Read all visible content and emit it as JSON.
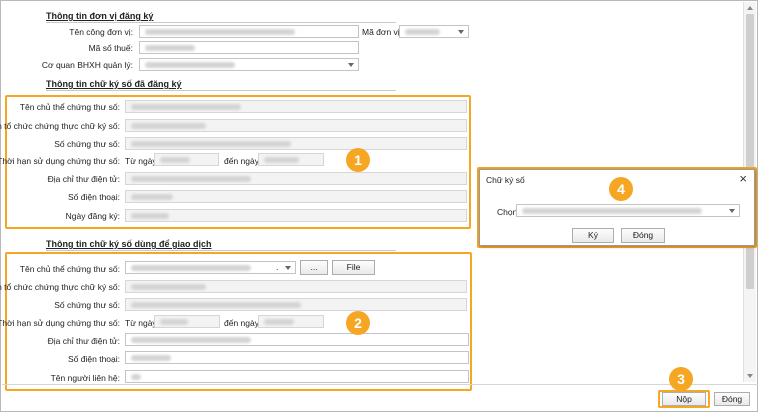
{
  "section_registration": {
    "title": "Thông tin đơn vị đăng ký",
    "unit_name_label": "Tên công đơn vị:",
    "unit_code_label": "Mã đơn vị:",
    "tax_code_label": "Mã số thuế:",
    "agency_label": "Cơ quan BHXH quản lý:"
  },
  "section_registered_cert": {
    "title": "Thông tin chữ ký số đã đăng ký",
    "owner_label": "Tên chủ thể chứng thư số:",
    "issuer_label": "Tên tổ chức chứng thực chữ ký số:",
    "serial_label": "Số chứng thư số:",
    "validity_label": "Thời hạn sử dụng chứng thư số:",
    "from_label": "Từ ngày",
    "to_label": "đến ngày",
    "email_label": "Địa chỉ thư điện tử:",
    "phone_label": "Số điện thoại:",
    "reg_date_label": "Ngày đăng ký:"
  },
  "section_transaction_cert": {
    "title": "Thông tin chữ ký số dùng để giao dịch",
    "owner_label": "Tên chủ thể chứng thư số:",
    "owner_suffix": ".",
    "browse_button": "...",
    "file_button": "File",
    "issuer_label": "Tên tổ chức chứng thực chữ ký số:",
    "serial_label": "Số chứng thư số:",
    "validity_label": "Thời hạn sử dụng chứng thư số:",
    "from_label": "Từ ngày",
    "to_label": "đến ngày",
    "email_label": "Địa chỉ thư điện tử:",
    "phone_label": "Số điện thoại:",
    "contact_label": "Tên người liên hệ:"
  },
  "sign_dialog": {
    "title": "Chữ ký số",
    "close_icon": "close-icon",
    "choose_label": "Chọn",
    "sign_button": "Ký",
    "close_button": "Đóng"
  },
  "footer": {
    "submit_button": "Nộp",
    "close_button": "Đóng"
  },
  "badges": [
    "1",
    "2",
    "3",
    "4"
  ],
  "colors": {
    "highlight": "#f5a623",
    "field_border": "#c4c4c4",
    "readonly_field": "#f3f3f3"
  }
}
